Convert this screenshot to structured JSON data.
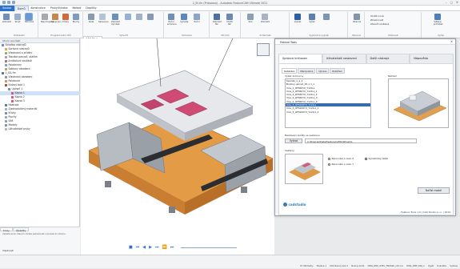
{
  "window": {
    "title": "2_Sil.fm (Prikazano) - Autodesk FeatureCAM Ultimate 2021",
    "controls": [
      "–",
      "▢",
      "✕"
    ]
  },
  "menu": [
    "Soubor",
    "Domů",
    "Konstrukce",
    "Prvky/Výroba",
    "Nářadí",
    "Doplňky"
  ],
  "ribbon": {
    "groups": [
      {
        "label": "Zobrazení",
        "buttons": [
          "Zobrazit",
          "Skrýt",
          "Stínovat"
        ]
      },
      {
        "label": "Programování dílů",
        "buttons": [
          "Neuchopené",
          "Spojovací",
          "Křivky",
          "Plochy"
        ]
      },
      {
        "label": "Vytvořit",
        "buttons": [
          "Sada",
          "Sekvence",
          "Zobrazit Výrobek"
        ]
      },
      {
        "label": "Simulace",
        "buttons": [
          "Ruční simulace",
          "Vyzvěte",
          "Ruční"
        ]
      },
      {
        "label": "NC kód",
        "buttons": [
          "Zobrazit NC",
          "Uložit NC"
        ]
      },
      {
        "label": "Schémata",
        "buttons": [
          "Kód",
          "Zobrazit"
        ]
      },
      {
        "label": "Vyjmout a vyzvat",
        "buttons": [
          "Vybrat",
          "Výřez"
        ]
      },
      {
        "label": "Obecné",
        "buttons": [
          "Obecné"
        ]
      },
      {
        "label": "Možnosti",
        "buttons": [
          "Uložit nové",
          "Zkopírovat",
          "Otevřít uložené"
        ]
      },
      {
        "label": "Výřez",
        "buttons": [
          "Sdílené prohlížeč"
        ]
      }
    ]
  },
  "left_panel": {
    "header": "Strom součástí",
    "tree": [
      "Skladba nástrojů",
      "Správce nástrojů",
      "Vlastnosti a přidání",
      "Tabulka posuvů, otáček",
      "Antikolizní součásti",
      "Polotovary",
      "Šablony obrobení",
      "2_SIL.fm",
      "Vlastnosti obrobení",
      "Polotovar",
      "Nulový bod 1",
      "Upínač 1",
      "Kapsa 1",
      "Kapsa 2",
      "Kapsa 3",
      "Nástroje",
      "Zjednodušený materiál",
      "Křivky",
      "Plochy",
      "Sítě",
      "Modely",
      "Uživatelské prvky"
    ],
    "selected_index": 12,
    "bottom_tabs": [
      "Kroky",
      "Výsledky"
    ],
    "info_text": "Vyberte krok, kterým chcete pokračovat v úpravě do stromu.",
    "message": "Vlastnosti"
  },
  "viewport": {
    "tab": "2_SIL.fm ×"
  },
  "dialog": {
    "title": "Feature Tools",
    "tabs": [
      "Správce knihoven",
      "Uživatelské nastavení",
      "Další nástroje",
      "Nápověda"
    ],
    "subtabs": [
      "Databáze",
      "Manipulace",
      "Úprava",
      "Rozšíření"
    ],
    "list_label": "Výběr knihovny",
    "preview_label": "Náhled",
    "list_items": [
      "Šponěk_1_a_1",
      "Bodový upínač_Z1 x 1_z",
      "Vice_2_OFS50YX_Y120-z",
      "Vice_2_OFS50YX_Y120-z_1",
      "Vice_2_OFS50YX_Y120-z_2",
      "Vice_2_OFS50YX_Y120-z_3",
      "Vice_2_OFS50YX_Y120-z_4",
      "Vice_3_OFS100YX_Y120-z",
      "Vice_3_OFS100YX_Y120-z_1",
      "Vice_3_OFS100YX_Y120-z_2"
    ],
    "list_selected": 7,
    "path_label": "Nastavení složky se sestavou",
    "path_button": "Vybrat",
    "path_value": "C:\\ProgramData\\FeatureCAM\\CSPlus\\CL",
    "place_label": "Sestavy",
    "radio_options": [
      "Zarovnání s osou X",
      "Zarovnání s osou Y"
    ],
    "radio_selected": 0,
    "checkbox_label": "Symetrický řetěz",
    "button_insert": "Načíst model",
    "logo": "cadstudio",
    "footer": "Feature Tools 1.0  |  CAD Studio s.r.o. | 2019"
  },
  "status": [
    "Hl: Milimetry",
    "Hladina 1",
    "UCS Nulový bod 1",
    "Nulový bod1",
    "DMG_DMC_635V_TNC640_v15.cnc",
    "DMG_DMP_Dl6_in",
    "Vyjetí",
    "8 skratku",
    "Vydána"
  ],
  "colors": {
    "accent": "#2d72c6",
    "orange": "#e8a04a",
    "gray": "#b9bec5"
  }
}
